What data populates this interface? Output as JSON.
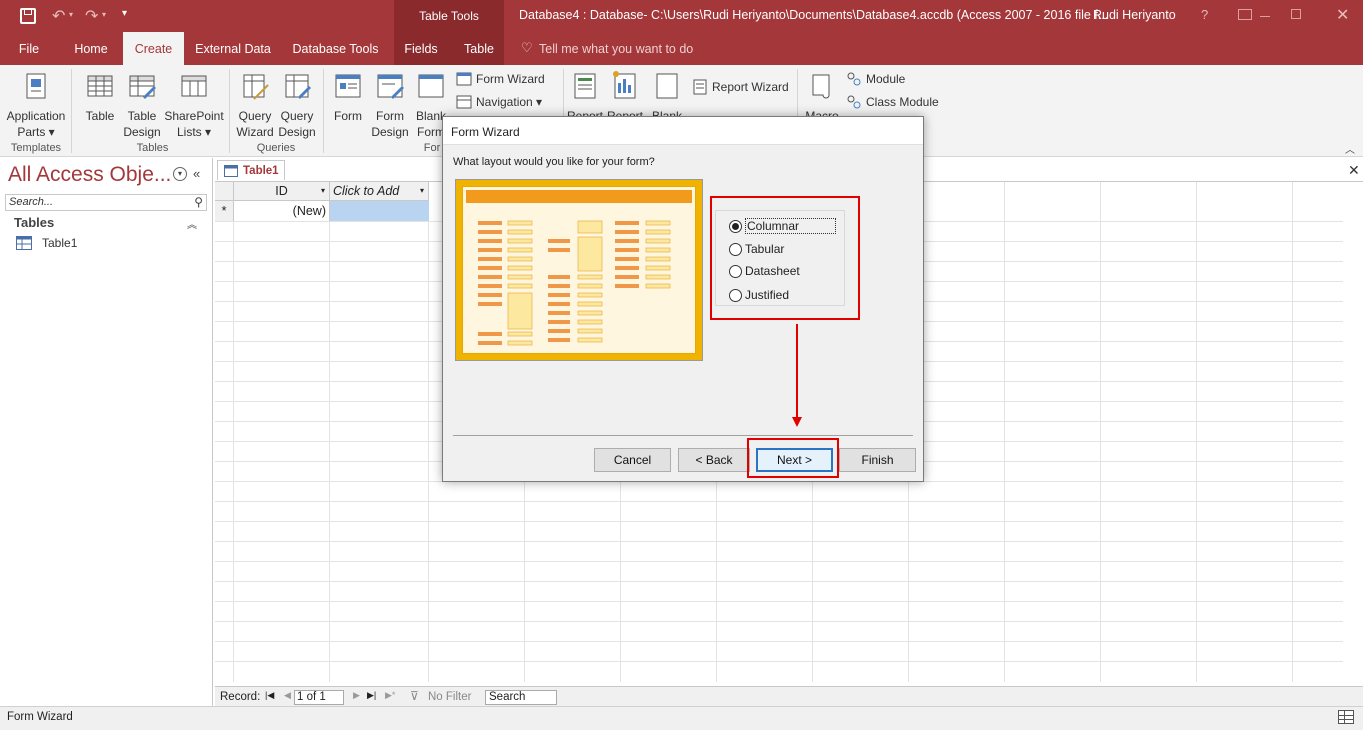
{
  "title_bar": {
    "table_tools": "Table Tools",
    "title": "Database4 : Database- C:\\Users\\Rudi Heriyanto\\Documents\\Database4.accdb (Access 2007 - 2016 file f...",
    "user": "Rudi Heriyanto",
    "help": "?"
  },
  "tabs": {
    "file": "File",
    "home": "Home",
    "create": "Create",
    "external": "External Data",
    "dbtools": "Database Tools",
    "fields": "Fields",
    "table": "Table",
    "tellme": "Tell me what you want to do"
  },
  "ribbon": {
    "app_parts": [
      "Application",
      "Parts ▾"
    ],
    "table": "Table",
    "table_design": [
      "Table",
      "Design"
    ],
    "sharepoint": [
      "SharePoint",
      "Lists ▾"
    ],
    "query_wizard": [
      "Query",
      "Wizard"
    ],
    "query_design": [
      "Query",
      "Design"
    ],
    "form": "Form",
    "form_design": [
      "Form",
      "Design"
    ],
    "blank_form": [
      "Blank",
      "Form"
    ],
    "form_wizard": "Form Wizard",
    "navigation": "Navigation ▾",
    "report": "Report",
    "report_design": "Report",
    "blank_report": "Blank",
    "report_wizard": "Report Wizard",
    "macro": "Macro",
    "module": "Module",
    "class_module": "Class Module",
    "groups": {
      "templates": "Templates",
      "tables": "Tables",
      "queries": "Queries",
      "forms": "For"
    }
  },
  "nav_pane": {
    "title": "All Access Obje...",
    "search_placeholder": "Search...",
    "section": "Tables",
    "items": [
      "Table1"
    ]
  },
  "datasheet": {
    "tab": "Table1",
    "columns": [
      "ID",
      "Click to Add"
    ],
    "new_row": "(New)",
    "record_label": "Record:",
    "record_value": "1 of 1",
    "no_filter": "No Filter",
    "search": "Search"
  },
  "status": {
    "text": "Form Wizard"
  },
  "dialog": {
    "title": "Form Wizard",
    "question": "What layout would you like for your form?",
    "options": [
      {
        "label": "Columnar",
        "selected": true
      },
      {
        "label": "Tabular",
        "selected": false
      },
      {
        "label": "Datasheet",
        "selected": false
      },
      {
        "label": "Justified",
        "selected": false
      }
    ],
    "buttons": {
      "cancel": "Cancel",
      "back": "< Back",
      "next": "Next >",
      "finish": "Finish"
    }
  },
  "colors": {
    "accent": "#a4373a",
    "highlight_box": "#e00000",
    "selection": "#b8d4f0"
  }
}
